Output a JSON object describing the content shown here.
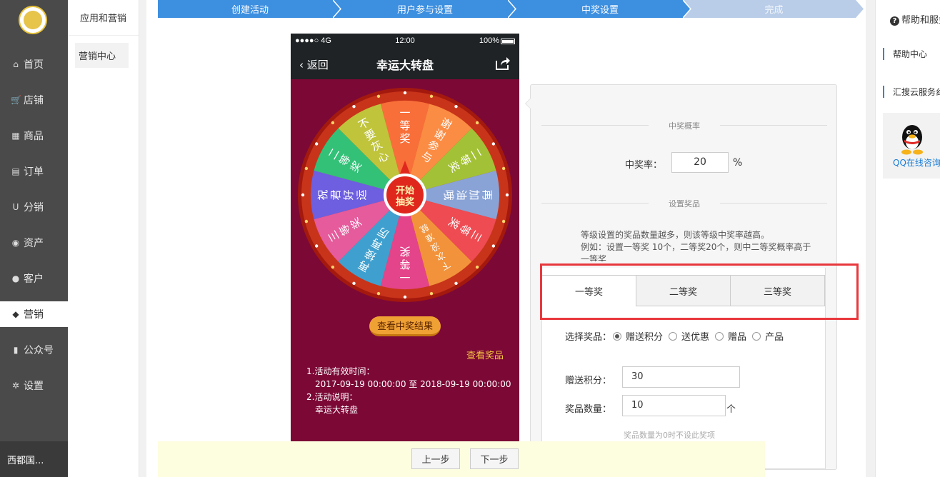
{
  "leftnav": {
    "items": [
      {
        "label": "首页",
        "icon": "home-icon"
      },
      {
        "label": "店铺",
        "icon": "cart-icon"
      },
      {
        "label": "商品",
        "icon": "gift-icon"
      },
      {
        "label": "订单",
        "icon": "document-icon"
      },
      {
        "label": "分销",
        "icon": "magnet-icon"
      },
      {
        "label": "资产",
        "icon": "coin-icon"
      },
      {
        "label": "客户",
        "icon": "user-icon"
      },
      {
        "label": "营销",
        "icon": "tags-icon",
        "active": true
      },
      {
        "label": "公众号",
        "icon": "book-icon"
      },
      {
        "label": "设置",
        "icon": "gear-icon"
      }
    ],
    "shop_name": "西都国..."
  },
  "subnav": {
    "heading": "应用和营销",
    "item": "营销中心"
  },
  "steps": [
    "创建活动",
    "用户参与设置",
    "中奖设置",
    "完成"
  ],
  "phone": {
    "carrier": "●●●●○ 4G",
    "time": "12:00",
    "battery": "100%",
    "back": "返回",
    "title": "幸运大转盘",
    "wheel_segments": [
      "一等奖",
      "谢谢参与",
      "二等奖",
      "再加油哦",
      "三等奖",
      "下次没准就能中哦",
      "一等奖",
      "再接再厉",
      "三等奖",
      "祝君好运",
      "二等奖",
      "不要灰心"
    ],
    "center_button": [
      "开始",
      "抽奖"
    ],
    "result_button": "查看中奖结果",
    "view_prize": "查看奖品",
    "rules": {
      "time_label": "1.活动有效时间：",
      "time_value": "2017-09-19 00:00:00 至 2018-09-19 00:00:00",
      "desc_label": "2.活动说明：",
      "desc_value": "幸运大转盘"
    }
  },
  "panel": {
    "rate_section": "中奖概率",
    "rate_label": "中奖率：",
    "rate_value": "20",
    "rate_unit": "%",
    "prize_section": "设置奖品",
    "tip_line1": "等级设置的奖品数量越多，则该等级中奖率越高。",
    "tip_line2": "例如：设置一等奖 10个，二等奖20个，则中二等奖概率高于一等奖",
    "tabs": [
      "一等奖",
      "二等奖",
      "三等奖"
    ],
    "choose_label": "选择奖品：",
    "choose_options": [
      "赠送积分",
      "送优惠",
      "赠品",
      "产品"
    ],
    "points_label": "赠送积分：",
    "points_value": "30",
    "qty_label": "奖品数量：",
    "qty_value": "10",
    "qty_unit": "个",
    "hint": "奖品数量为0时不设此奖项"
  },
  "bottom": {
    "prev": "上一步",
    "next": "下一步"
  },
  "help": {
    "title": "帮助和服务",
    "links": [
      "帮助中心",
      "汇搜云服务纟"
    ],
    "qq": "QQ在线咨询"
  },
  "colors": {
    "step_active": "#3d8fe0",
    "step_inactive": "#b9cde8",
    "phone_bg": "#7c0836",
    "highlight": "#e8383d"
  }
}
